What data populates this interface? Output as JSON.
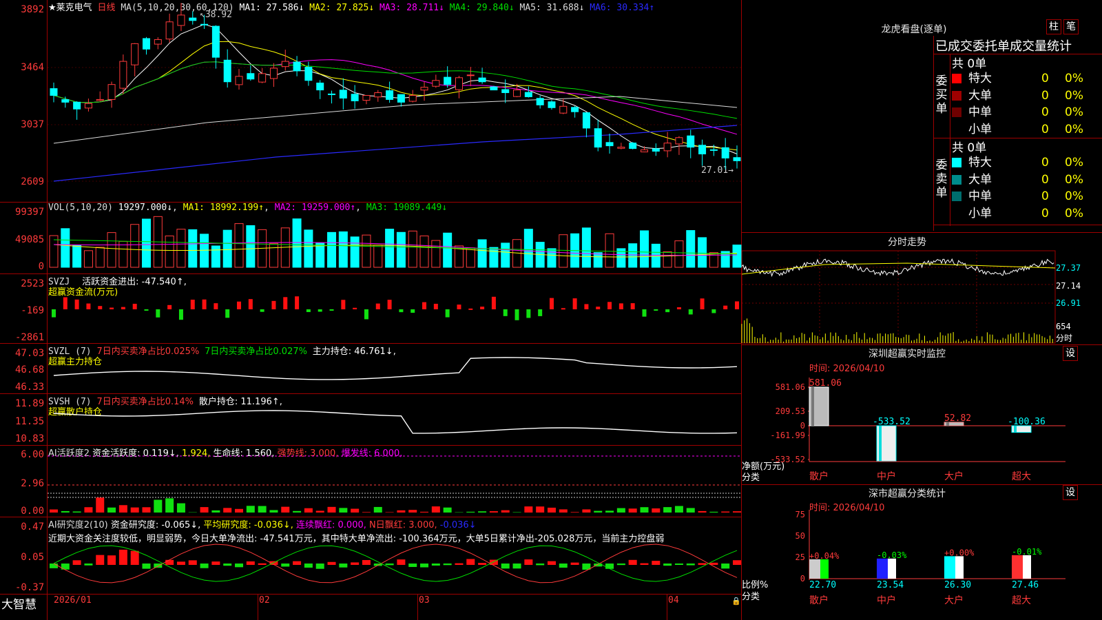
{
  "stock": {
    "name": "★莱克电气",
    "period": "日线",
    "ma_header": "MA(5,10,20,30,60,120)",
    "ma": [
      {
        "label": "MA1: 27.586↓",
        "color": "#ffffff"
      },
      {
        "label": "MA2: 27.825↓",
        "color": "#ffff00"
      },
      {
        "label": "MA3: 28.711↓",
        "color": "#ff00ff"
      },
      {
        "label": "MA4: 29.840↓",
        "color": "#00e000"
      },
      {
        "label": "MA5: 31.688↓",
        "color": "#dddddd"
      },
      {
        "label": "MA6: 30.334↑",
        "color": "#2020ff"
      }
    ],
    "price_axis": [
      "3892",
      "3464",
      "3037",
      "2609"
    ],
    "high_note": "38.92",
    "low_note": "27.01"
  },
  "volume": {
    "header": "VOL(5,10,20)",
    "value": "19297.000↓",
    "mas": [
      {
        "label": "MA1: 18992.199↑",
        "color": "#ffff00"
      },
      {
        "label": "MA2: 19259.000↑",
        "color": "#ff00ff"
      },
      {
        "label": "MA3: 19089.449↓",
        "color": "#00e000"
      }
    ],
    "axis": [
      "99397",
      "49085",
      "0"
    ]
  },
  "svzj": {
    "header": "SVZJ",
    "line1": "活跃资金进出: -47.540↑,",
    "line2": "超赢资金流(万元)",
    "axis": [
      "2523",
      "-169",
      "-2861"
    ]
  },
  "svzl": {
    "header": "SVZL (7)",
    "a": "7日内买卖净占比0.025%",
    "b": "7日内买卖净占比0.027%",
    "c": "主力持仓: 46.761↓,",
    "line2": "超赢主力持仓",
    "axis": [
      "47.03",
      "46.68",
      "46.33"
    ]
  },
  "svsh": {
    "header": "SVSH (7)",
    "a": "7日内买卖净占比0.14%",
    "c": "散户持仓: 11.196↑,",
    "line2": "超赢散户持仓",
    "axis": [
      "11.89",
      "11.35",
      "10.83"
    ]
  },
  "ai1": {
    "header": "AI活跃度2",
    "a": "资金活跃度: 0.119↓,",
    "b": "1.924,",
    "c": "生命线: 1.560,",
    "d": "强势线: 3.000,",
    "e": "爆发线: 6.000,",
    "axis": [
      "6.00",
      "2.96",
      "0.00"
    ]
  },
  "ai2": {
    "header": "AI研究度2(10)",
    "a": "资金研究度: -0.065↓,",
    "b": "平均研究度: -0.036↓,",
    "c": "连续飘红: 0.000,",
    "d": "N日飘红: 3.000,",
    "e": "-0.036↓",
    "comment": "近期大资金关注度较低，明显弱势，今日大单净流出: -47.541万元，其中特大单净流出: -100.364万元，大单5日累计净出-205.028万元，当前主力控盘弱",
    "axis": [
      "0.47",
      "0.05",
      "-0.37"
    ]
  },
  "bottom": {
    "brand": "大智慧",
    "dates": [
      "2026/01",
      "02",
      "03",
      "04"
    ]
  },
  "right": {
    "dragon_title": "龙虎看盘(逐单)",
    "btn_a": "柱",
    "btn_b": "笔",
    "order_header": "已成交委托单成交量统计",
    "buy_label": "委买单",
    "sell_label": "委卖单",
    "buy_total": "共 0单",
    "sell_total": "共 0单",
    "buy_rows": [
      {
        "name": "特大",
        "qty": "0",
        "pct": "0%",
        "color": "#ff0000"
      },
      {
        "name": "大单",
        "qty": "0",
        "pct": "0%",
        "color": "#a00000"
      },
      {
        "name": "中单",
        "qty": "0",
        "pct": "0%",
        "color": "#700000"
      },
      {
        "name": "小单",
        "qty": "0",
        "pct": "0%",
        "color": "#000000"
      }
    ],
    "sell_rows": [
      {
        "name": "特大",
        "qty": "0",
        "pct": "0%",
        "color": "#00ffff"
      },
      {
        "name": "大单",
        "qty": "0",
        "pct": "0%",
        "color": "#008c8c"
      },
      {
        "name": "中单",
        "qty": "0",
        "pct": "0%",
        "color": "#006e6e"
      },
      {
        "name": "小单",
        "qty": "0",
        "pct": "0%",
        "color": "#000000"
      }
    ],
    "intraday_title": "分时走势",
    "intraday_axis": [
      "27.37",
      "27.14",
      "26.91"
    ],
    "intraday_vol": "654",
    "intraday_unit": "分时",
    "monitor_title": "深圳超赢实时监控",
    "monitor_btn": "设",
    "monitor_time": "时间: 2026/04/10",
    "monitor_axis": [
      "581.06",
      "209.53",
      "0",
      "-161.99",
      "-533.52"
    ],
    "monitor_ylabel1": "净额(万元)",
    "monitor_ylabel2": "分类",
    "monitor_bars": [
      {
        "cat": "散户",
        "value": 581.06,
        "label": "581.06"
      },
      {
        "cat": "中户",
        "value": -533.52,
        "label": "-533.52"
      },
      {
        "cat": "大户",
        "value": 52.82,
        "label": "52.82"
      },
      {
        "cat": "超大",
        "value": -100.36,
        "label": "-100.36"
      }
    ],
    "class_title": "深市超赢分类统计",
    "class_btn": "设",
    "class_time": "时间: 2026/04/10",
    "class_axis": [
      "75",
      "50",
      "25",
      "0"
    ],
    "class_ylabel1": "比例%",
    "class_ylabel2": "分类",
    "class_bars": [
      {
        "cat": "散户",
        "value": 22.7,
        "label": "22.70",
        "change": "+0.04%"
      },
      {
        "cat": "中户",
        "value": 23.54,
        "label": "23.54",
        "change": "-0.03%"
      },
      {
        "cat": "大户",
        "value": 26.3,
        "label": "26.30",
        "change": "+0.00%"
      },
      {
        "cat": "超大",
        "value": 27.46,
        "label": "27.46",
        "change": "-0.01%"
      }
    ]
  },
  "chart_data": {
    "type": "bar",
    "title": "",
    "categories": [
      "散户",
      "中户",
      "大户",
      "超大"
    ],
    "series": [
      {
        "values": [
          581.06,
          -533.52,
          52.82,
          -100.36
        ]
      }
    ],
    "ylabel": "净额(万元)",
    "ylim": [
      -533.52,
      581.06
    ]
  }
}
